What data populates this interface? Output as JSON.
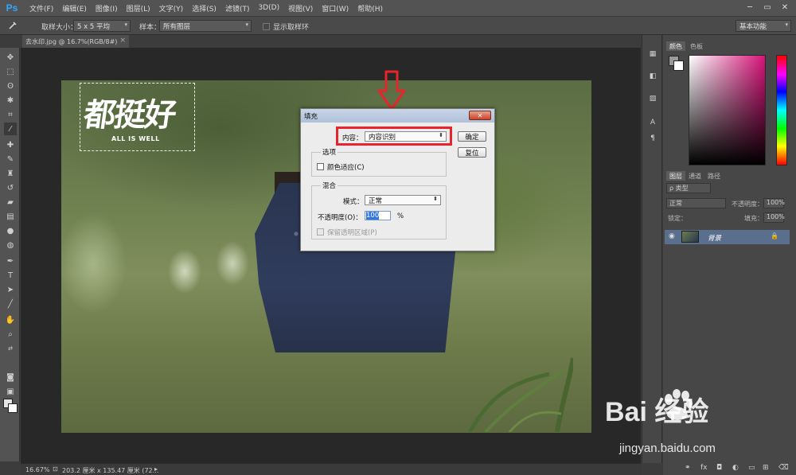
{
  "app": {
    "logo": "Ps"
  },
  "menu": [
    "文件(F)",
    "编辑(E)",
    "图像(I)",
    "图层(L)",
    "文字(Y)",
    "选择(S)",
    "滤镜(T)",
    "3D(D)",
    "视图(V)",
    "窗口(W)",
    "帮助(H)"
  ],
  "window_controls": [
    "─",
    "▭",
    "✕"
  ],
  "options": {
    "sample_size_label": "取样大小：",
    "sample_size_value": "5 x 5 平均",
    "sample_label": "样本：",
    "sample_value": "所有图层",
    "show_ring_label": "显示取样环",
    "workspace_value": "基本功能"
  },
  "document": {
    "tab_title": "去水印.jpg @ 16.7%(RGB/8#)",
    "close": "×"
  },
  "watermark": {
    "main": "都挺好",
    "sub": "ALL IS WELL"
  },
  "dialog": {
    "title": "填充",
    "close": "✕",
    "content_label": "内容：",
    "content_value": "内容识别",
    "ok_label": "确定",
    "reset_label": "复位",
    "options_title": "选项",
    "color_adapt_label": "颜色适应(C)",
    "blend_title": "混合",
    "mode_label": "模式：",
    "mode_value": "正常",
    "opacity_label": "不透明度(O)：",
    "opacity_value": "100",
    "opacity_unit": "%",
    "preserve_label": "保留透明区域(P)"
  },
  "panels": {
    "color_tab": "颜色",
    "swatch_tab": "色板",
    "layers_tab": "图层",
    "channels_tab": "通道",
    "paths_tab": "路径",
    "kind_value": "ρ 类型",
    "blend_value": "正常",
    "opacity_label": "不透明度：",
    "opacity_value": "100%",
    "lock_label": "锁定：",
    "fill_label": "填充：",
    "fill_value": "100%",
    "layer_name": "背景"
  },
  "status": {
    "zoom": "16.67%",
    "doc_info": "203.2 厘米 x 135.47 厘米 (72..."
  },
  "brand": {
    "baidu": "Bai  经验",
    "url": "jingyan.baidu.com"
  }
}
